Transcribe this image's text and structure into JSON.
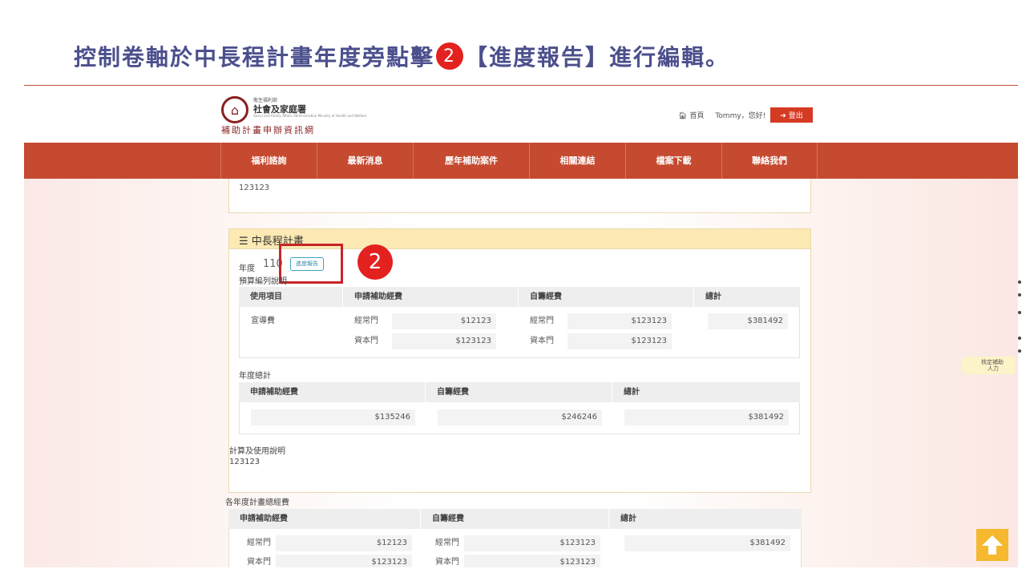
{
  "slide": {
    "title_before": "控制卷軸於中長程計畫年度旁點擊",
    "step": "2",
    "title_after": "【進度報告】進行編輯。"
  },
  "header": {
    "logo_line1": "衛生福利部",
    "logo_line2": "社會及家庭署",
    "logo_line3": "Social and Family Affairs Administration Ministry of Health and Welfare",
    "site_name": "補助計畫申辦資訊網",
    "home": "首頁",
    "greeting": "Tommy，您好!",
    "logout": "登出"
  },
  "nav": [
    "福利諮詢",
    "最新消息",
    "歷年補助案件",
    "相關連結",
    "檔案下載",
    "聯絡我們"
  ],
  "prev_card": {
    "text": "123123"
  },
  "plan": {
    "title": "中長程計畫",
    "year_label": "年度",
    "year_value": "110",
    "report_button": "進度報告",
    "callout": "2",
    "budget_label": "預算編列說明",
    "budget_headers": [
      "使用項目",
      "申請補助經費",
      "自籌經費",
      "總計"
    ],
    "budget_row": {
      "item": "宣導費",
      "apply_label_1": "經常門",
      "apply_value_1": "$12123",
      "apply_label_2": "資本門",
      "apply_value_2": "$123123",
      "self_label_1": "經常門",
      "self_value_1": "$123123",
      "self_label_2": "資本門",
      "self_value_2": "$123123",
      "total": "$381492"
    },
    "annual_label": "年度總計",
    "annual_headers": [
      "申請補助經費",
      "自籌經費",
      "總計"
    ],
    "annual_values": [
      "$135246",
      "$246246",
      "$381492"
    ],
    "calc_label": "計算及使用說明",
    "calc_value": "123123"
  },
  "yearly": {
    "label": "各年度計畫總經費",
    "headers": [
      "申請補助經費",
      "自籌經費",
      "總計"
    ],
    "apply_label_1": "經常門",
    "apply_value_1": "$12123",
    "apply_label_2": "資本門",
    "apply_value_2": "$123123",
    "self_label_1": "經常門",
    "self_value_1": "$123123",
    "self_label_2": "資本門",
    "self_value_2": "$123123",
    "total": "$381492"
  },
  "side_tab": {
    "line1": "核定補助",
    "line2": "人力"
  }
}
